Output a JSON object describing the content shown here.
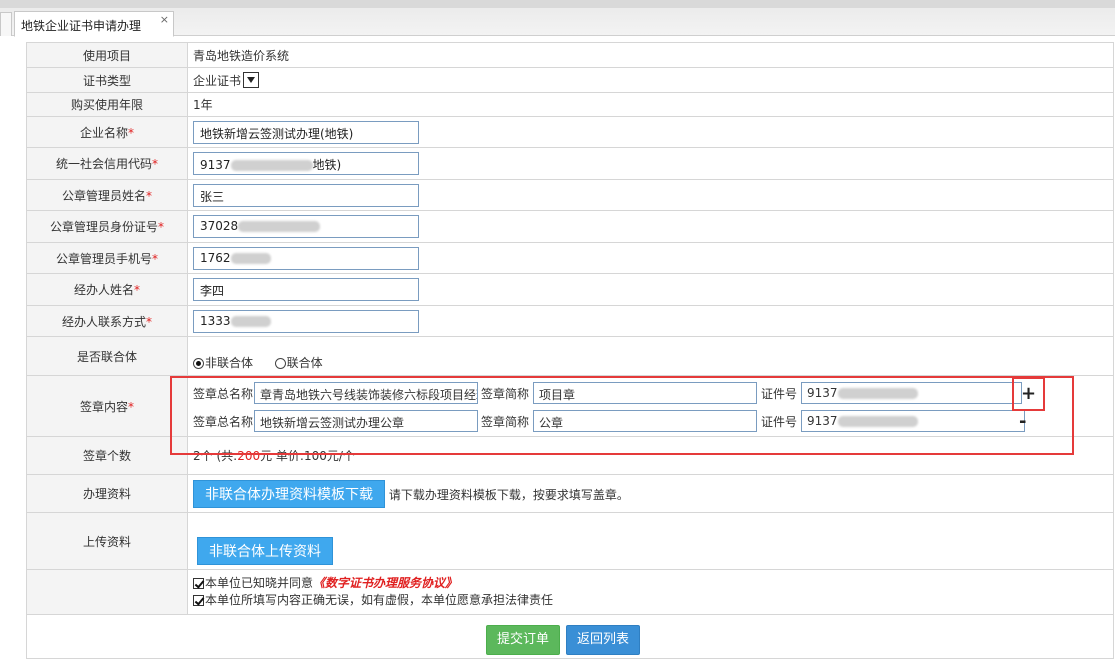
{
  "tab": {
    "title": "地铁企业证书申请办理",
    "close": "×"
  },
  "fields": {
    "project": {
      "label": "使用项目",
      "value": "青岛地铁造价系统"
    },
    "cert_type": {
      "label": "证书类型",
      "value": "企业证书"
    },
    "years": {
      "label": "购买使用年限",
      "value": "1年"
    },
    "company": {
      "label": "企业名称",
      "value": "地铁新增云签测试办理(地铁)"
    },
    "credit_code": {
      "label": "统一社会信用代码",
      "value_prefix": "9137",
      "value_suffix": "地铁)"
    },
    "admin_name": {
      "label": "公章管理员姓名",
      "value": "张三"
    },
    "admin_id": {
      "label": "公章管理员身份证号",
      "value_prefix": "37028"
    },
    "admin_phone": {
      "label": "公章管理员手机号",
      "value_prefix": "1762"
    },
    "handler_name": {
      "label": "经办人姓名",
      "value": "李四"
    },
    "handler_contact": {
      "label": "经办人联系方式",
      "value_prefix": "1333"
    },
    "union": {
      "label": "是否联合体",
      "option_no": "非联合体",
      "option_yes": "联合体"
    },
    "seal": {
      "label": "签章内容",
      "full_name_label": "签章总名称",
      "short_name_label": "签章简称",
      "cert_no_label": "证件号",
      "rows": [
        {
          "full_name": "章青岛地铁六号线装饰装修六标段项目经理部",
          "short_name": "项目章",
          "cert_no": "9137"
        },
        {
          "full_name": "地铁新增云签测试办理公章",
          "short_name": "公章",
          "cert_no": "9137"
        }
      ],
      "add": "+",
      "remove": "-"
    },
    "seal_count": {
      "label": "签章个数",
      "text_a": "2个 (共:",
      "total": "200",
      "text_b": "元 单价:100元/个"
    },
    "materials": {
      "label": "办理资料",
      "button": "非联合体办理资料模板下载",
      "hint": "请下载办理资料模板下载，按要求填写盖章。"
    },
    "upload": {
      "label": "上传资料",
      "button": "非联合体上传资料"
    },
    "agree1_text": "本单位已知晓并同意",
    "agree1_link": "《数字证书办理服务协议》",
    "agree2_text": "本单位所填写内容正确无误，如有虚假，本单位愿意承担法律责任"
  },
  "actions": {
    "submit": "提交订单",
    "back": "返回列表"
  },
  "colors": {
    "required": "#e02020",
    "annotation": "#e53a3a",
    "primary": "#3fa8ee",
    "submit": "#5cb85c"
  }
}
